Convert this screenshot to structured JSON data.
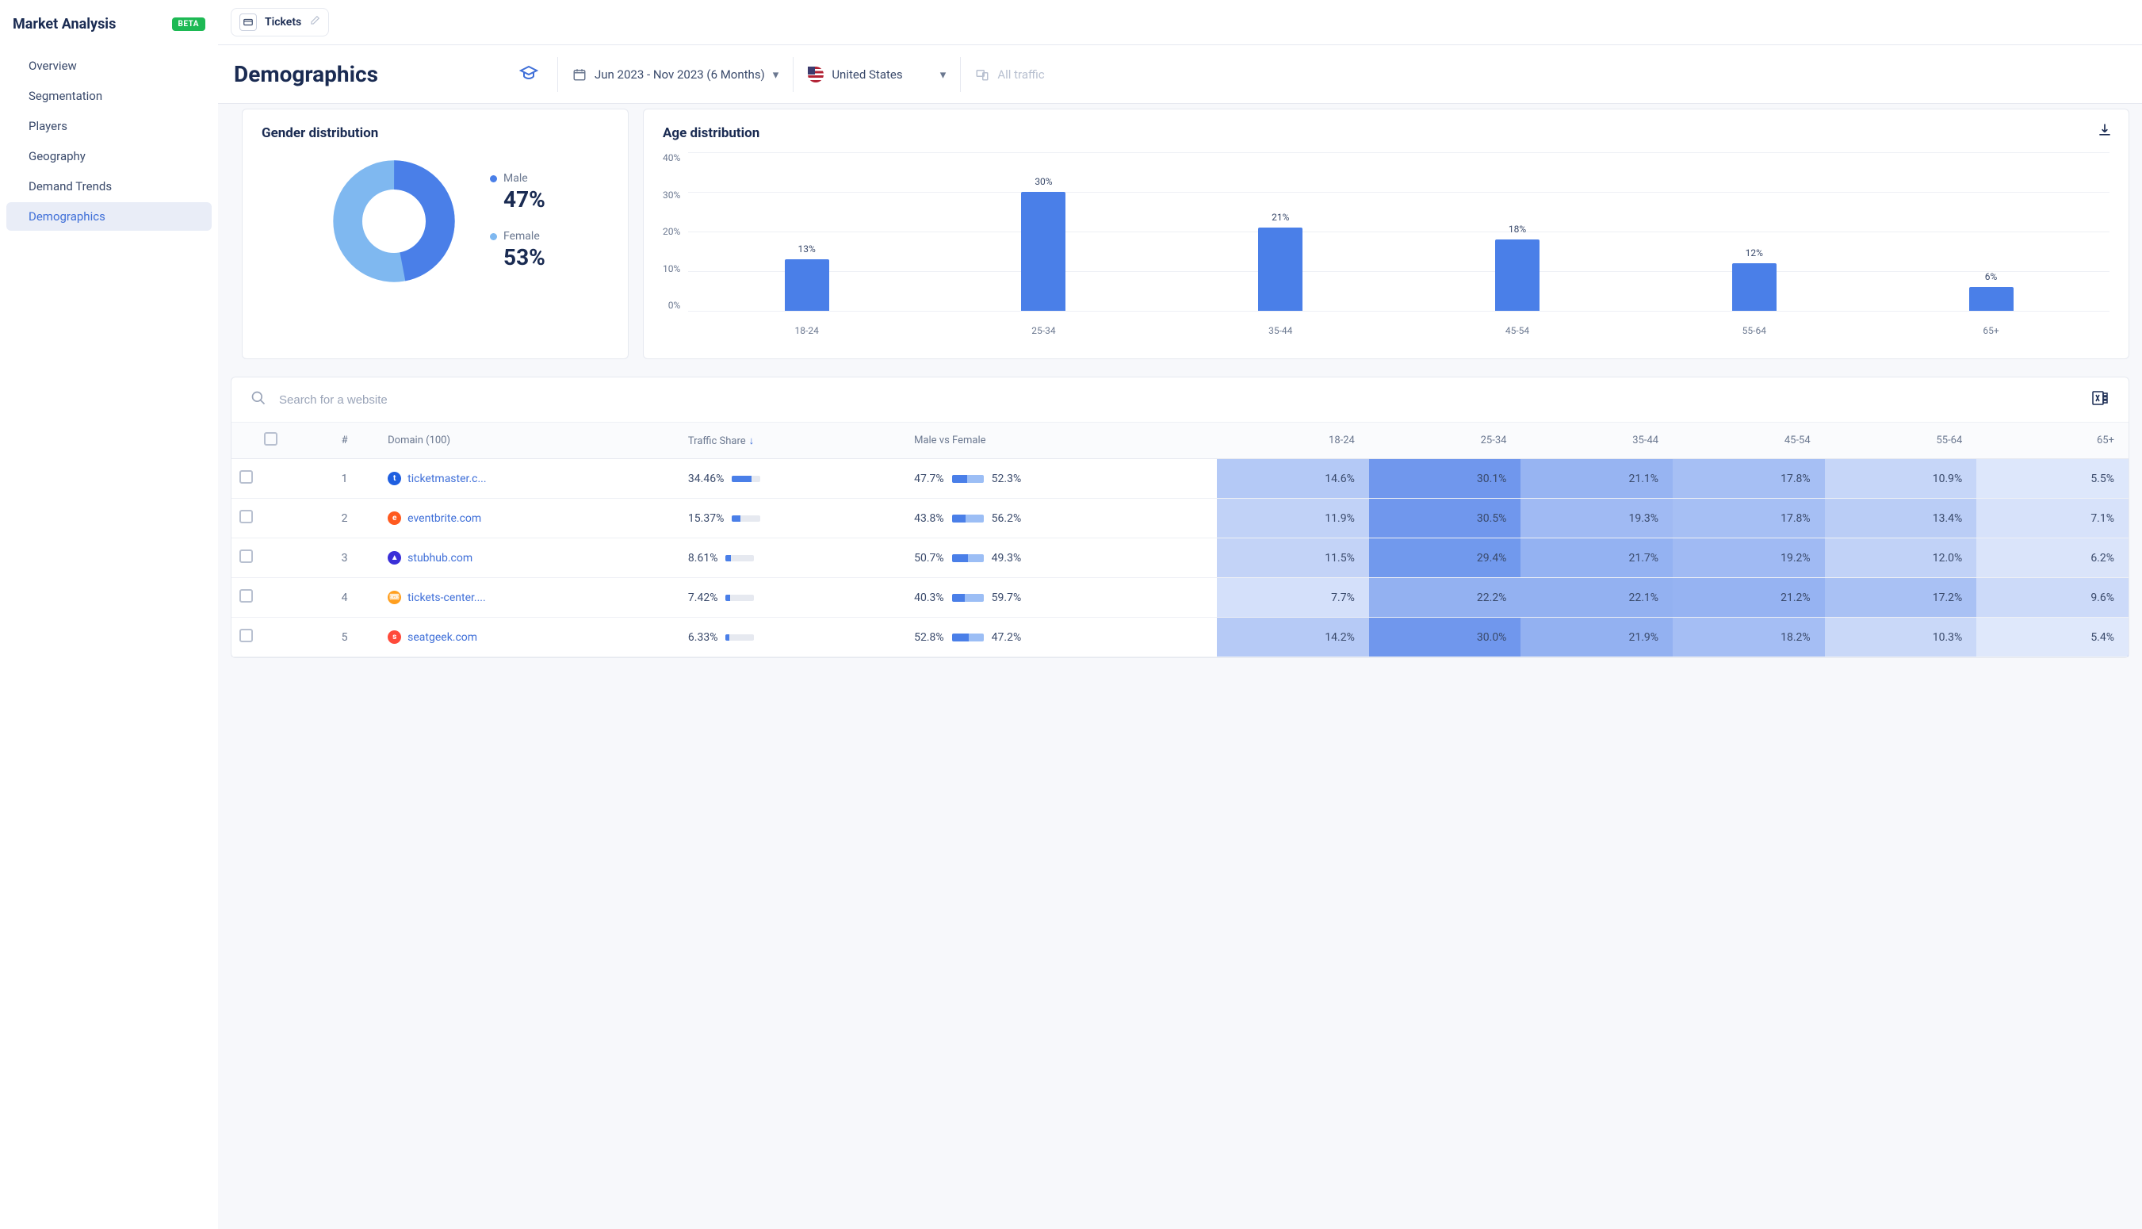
{
  "sidebar": {
    "title": "Market Analysis",
    "badge": "BETA",
    "items": [
      {
        "label": "Overview"
      },
      {
        "label": "Segmentation"
      },
      {
        "label": "Players"
      },
      {
        "label": "Geography"
      },
      {
        "label": "Demand Trends"
      },
      {
        "label": "Demographics",
        "active": true
      }
    ]
  },
  "tab": {
    "label": "Tickets"
  },
  "header": {
    "title": "Demographics",
    "date_range": "Jun 2023 - Nov 2023 (6 Months)",
    "country": "United States",
    "traffic_filter": "All traffic"
  },
  "gender_chart": {
    "title": "Gender distribution",
    "male_label": "Male",
    "male_value": "47%",
    "female_label": "Female",
    "female_value": "53%",
    "colors": {
      "male": "#4a7fe8",
      "female": "#7fb8f0"
    }
  },
  "age_chart": {
    "title": "Age distribution"
  },
  "chart_data": {
    "type": "bar",
    "categories": [
      "18-24",
      "25-34",
      "35-44",
      "45-54",
      "55-64",
      "65+"
    ],
    "values": [
      13,
      30,
      21,
      18,
      12,
      6
    ],
    "title": "Age distribution",
    "xlabel": "",
    "ylabel": "",
    "ylim": [
      0,
      40
    ],
    "yticks": [
      "40%",
      "30%",
      "20%",
      "10%",
      "0%"
    ]
  },
  "search": {
    "placeholder": "Search for a website"
  },
  "table": {
    "columns": {
      "num": "#",
      "domain": "Domain (100)",
      "traffic_share": "Traffic Share",
      "mvf": "Male vs Female",
      "a18": "18-24",
      "a25": "25-34",
      "a35": "35-44",
      "a45": "45-54",
      "a55": "55-64",
      "a65": "65+"
    },
    "rows": [
      {
        "n": "1",
        "domain": "ticketmaster.c...",
        "fav_bg": "#1f5fe0",
        "fav_txt": "t",
        "ts": "34.46%",
        "ts_w": 34.46,
        "male": "47.7%",
        "female": "52.3%",
        "m": 47.7,
        "a18": "14.6%",
        "a25": "30.1%",
        "a35": "21.1%",
        "a45": "17.8%",
        "a55": "10.9%",
        "a65": "5.5%"
      },
      {
        "n": "2",
        "domain": "eventbrite.com",
        "fav_bg": "#ff5a1f",
        "fav_txt": "e",
        "ts": "15.37%",
        "ts_w": 15.37,
        "male": "43.8%",
        "female": "56.2%",
        "m": 43.8,
        "a18": "11.9%",
        "a25": "30.5%",
        "a35": "19.3%",
        "a45": "17.8%",
        "a55": "13.4%",
        "a65": "7.1%"
      },
      {
        "n": "3",
        "domain": "stubhub.com",
        "fav_bg": "#3a2fd8",
        "fav_txt": "▲",
        "ts": "8.61%",
        "ts_w": 8.61,
        "male": "50.7%",
        "female": "49.3%",
        "m": 50.7,
        "a18": "11.5%",
        "a25": "29.4%",
        "a35": "21.7%",
        "a45": "19.2%",
        "a55": "12.0%",
        "a65": "6.2%"
      },
      {
        "n": "4",
        "domain": "tickets-center....",
        "fav_bg": "#ff9f1f",
        "fav_txt": "🎟",
        "ts": "7.42%",
        "ts_w": 7.42,
        "male": "40.3%",
        "female": "59.7%",
        "m": 40.3,
        "a18": "7.7%",
        "a25": "22.2%",
        "a35": "22.1%",
        "a45": "21.2%",
        "a55": "17.2%",
        "a65": "9.6%"
      },
      {
        "n": "5",
        "domain": "seatgeek.com",
        "fav_bg": "#ff4a3a",
        "fav_txt": "s",
        "ts": "6.33%",
        "ts_w": 6.33,
        "male": "52.8%",
        "female": "47.2%",
        "m": 52.8,
        "a18": "14.2%",
        "a25": "30.0%",
        "a35": "21.9%",
        "a45": "18.2%",
        "a55": "10.3%",
        "a65": "5.4%"
      }
    ]
  }
}
